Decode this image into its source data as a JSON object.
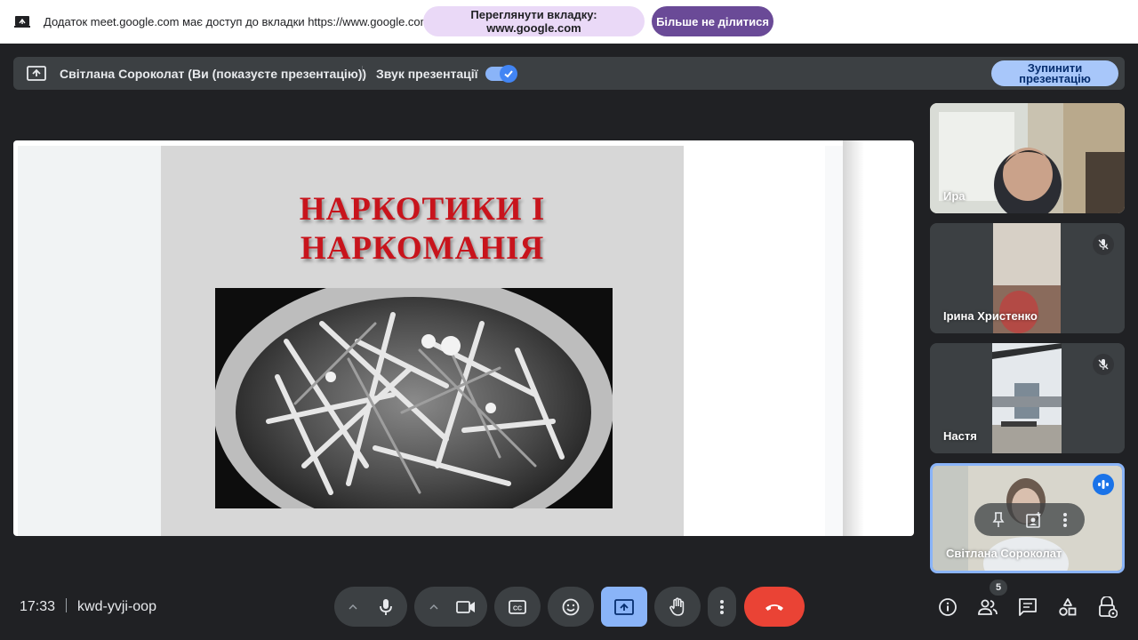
{
  "share_bar": {
    "message": "Додаток meet.google.com має доступ до вкладки https://www.google.com",
    "view_tab_label": "Переглянути вкладку: www.google.com",
    "stop_sharing_label": "Більше не ділитися"
  },
  "presenting_banner": {
    "presenter_text": "Світлана Сороколат (Ви (показуєте презентацію))",
    "audio_label": "Звук презентації",
    "audio_enabled": true,
    "stop_presenting_label": "Зупинити презентацію"
  },
  "slide": {
    "title_line1": "НАРКОТИКИ І",
    "title_line2": "НАРКОМАНІЯ"
  },
  "participants": [
    {
      "name": "Ира",
      "muted": false,
      "speaking": false
    },
    {
      "name": "Ірина Христенко",
      "muted": true,
      "speaking": false
    },
    {
      "name": "Настя",
      "muted": true,
      "speaking": false
    },
    {
      "name": "Світлана Сороколат",
      "muted": false,
      "speaking": true
    }
  ],
  "meeting": {
    "time": "17:33",
    "code": "kwd-yvji-oop",
    "people_count": "5"
  },
  "colors": {
    "hangup": "#ea4335",
    "accent_blue": "#8ab4f8",
    "share_purple": "#6a4a97"
  },
  "icons": {
    "controls": [
      "mic-icon",
      "camera-icon",
      "captions-icon",
      "emoji-icon",
      "present-icon",
      "raise-hand-icon",
      "more-options-icon",
      "hangup-icon"
    ],
    "right": [
      "info-icon",
      "people-icon",
      "chat-icon",
      "activities-icon",
      "host-controls-icon"
    ]
  }
}
